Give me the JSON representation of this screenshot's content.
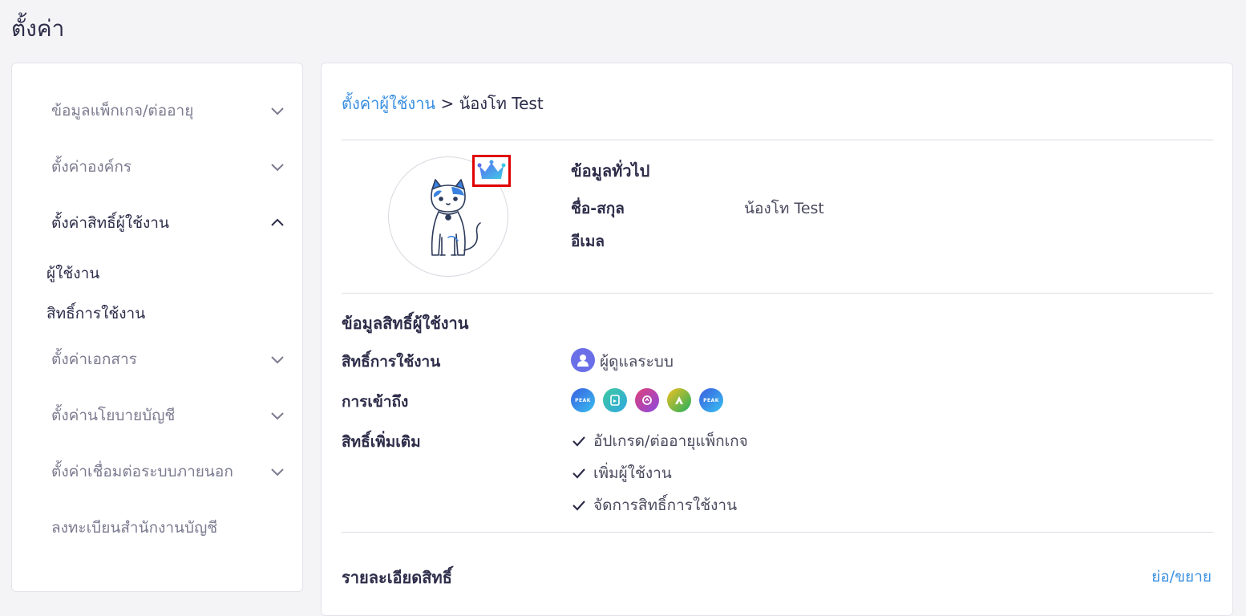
{
  "page": {
    "title": "ตั้งค่า"
  },
  "sidebar": {
    "items": [
      {
        "label": "ข้อมูลแพ็กเกจ/ต่ออายุ",
        "expanded": false
      },
      {
        "label": "ตั้งค่าองค์กร",
        "expanded": false
      },
      {
        "label": "ตั้งค่าสิทธิ์ผู้ใช้งาน",
        "expanded": true,
        "active": true,
        "sub_items": [
          {
            "label": "ผู้ใช้งาน"
          },
          {
            "label": "สิทธิ์การใช้งาน"
          }
        ]
      },
      {
        "label": "ตั้งค่าเอกสาร",
        "expanded": false
      },
      {
        "label": "ตั้งค่านโยบายบัญชี",
        "expanded": false
      },
      {
        "label": "ตั้งค่าเชื่อมต่อระบบภายนอก",
        "expanded": false
      },
      {
        "label": "ลงทะเบียนสำนักงานบัญชี"
      }
    ]
  },
  "breadcrumb": {
    "parent": "ตั้งค่าผู้ใช้งาน",
    "separator": ">",
    "current": "น้องโท Test"
  },
  "general_info": {
    "title": "ข้อมูลทั่วไป",
    "name_label": "ชื่อ-สกุล",
    "name_value": "น้องโท Test",
    "email_label": "อีเมล",
    "avatar_icon": "cat-avatar-icon",
    "badge_icon": "crown-icon"
  },
  "permission_info": {
    "title": "ข้อมูลสิทธิ์ผู้ใช้งาน",
    "role_label": "สิทธิ์การใช้งาน",
    "role_value": "ผู้ดูแลระบบ",
    "access_label": "การเข้าถึง",
    "apps": [
      {
        "icon": "peak-app-icon",
        "text": "PEAK",
        "color": "#3a7be0"
      },
      {
        "icon": "document-app-icon",
        "text": "",
        "color": "#2ec4a0"
      },
      {
        "icon": "circle-app-icon",
        "text": "",
        "color": "#e0507a"
      },
      {
        "icon": "arrow-app-icon",
        "text": "",
        "color": "#3bb54a"
      },
      {
        "icon": "peak-alt-app-icon",
        "text": "PEAK",
        "color": "#3a7be0"
      }
    ],
    "extra_label": "สิทธิ์เพิ่มเติม",
    "extras": [
      "อัปเกรด/ต่ออายุแพ็กเกจ",
      "เพิ่มผู้ใช้งาน",
      "จัดการสิทธิ์การใช้งาน"
    ]
  },
  "permission_detail": {
    "title": "รายละเอียดสิทธิ์",
    "toggle_label": "ย่อ/ขยาย"
  },
  "colors": {
    "accent": "#3a8fe0",
    "highlight_border": "#e00000",
    "role_icon_bg": "#6a6fe8"
  }
}
